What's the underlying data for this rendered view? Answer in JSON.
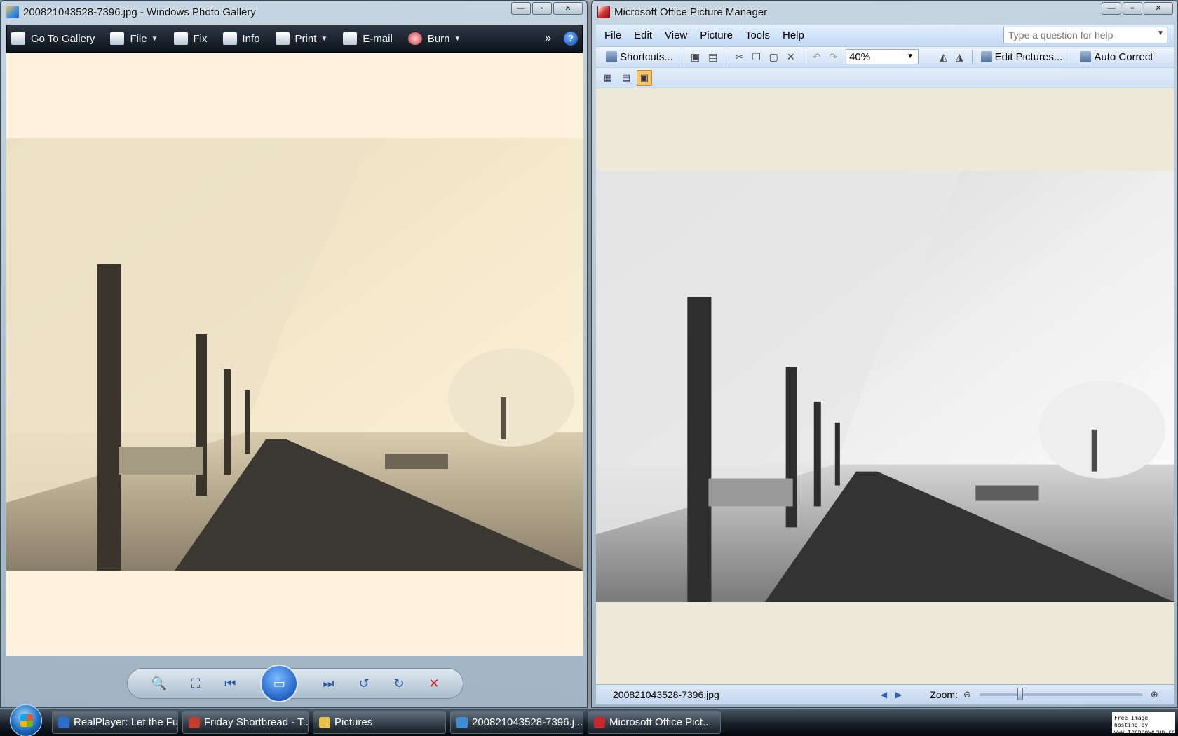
{
  "photo_gallery": {
    "title": "200821043528-7396.jpg - Windows Photo Gallery",
    "toolbar": [
      {
        "label": "Go To Gallery",
        "caret": false
      },
      {
        "label": "File",
        "caret": true
      },
      {
        "label": "Fix",
        "caret": false
      },
      {
        "label": "Info",
        "caret": false
      },
      {
        "label": "Print",
        "caret": true
      },
      {
        "label": "E-mail",
        "caret": false
      },
      {
        "label": "Burn",
        "caret": true
      }
    ],
    "more_label": "»",
    "help_label": "?",
    "controls": {
      "zoom": "🔍",
      "fit": "⛶",
      "prev": "⏮",
      "slideshow": "▭",
      "next": "⏭",
      "rotate_ccw": "↺",
      "rotate_cw": "↻",
      "delete": "✕"
    }
  },
  "picture_manager": {
    "title": "Microsoft Office Picture Manager",
    "menu": [
      "File",
      "Edit",
      "View",
      "Picture",
      "Tools",
      "Help"
    ],
    "help_placeholder": "Type a question for help",
    "toolbar": {
      "shortcuts_label": "Shortcuts...",
      "zoom_value": "40%",
      "edit_pictures_label": "Edit Pictures...",
      "auto_correct_label": "Auto Correct"
    },
    "status": {
      "filename": "200821043528-7396.jpg",
      "zoom_label": "Zoom:",
      "zoom_position": 0.25
    }
  },
  "taskbar": {
    "buttons": [
      {
        "label": "RealPlayer: Let the Fu...",
        "icon_color": "#2a6fd0"
      },
      {
        "label": "Friday Shortbread - T...",
        "icon_color": "#c83a2b"
      },
      {
        "label": "Pictures",
        "icon_color": "#e8c24a"
      },
      {
        "label": "200821043528-7396.j...",
        "icon_color": "#3d8ed8"
      },
      {
        "label": "Microsoft Office Pict...",
        "icon_color": "#c8282e"
      }
    ],
    "tray_text": "Free image hosting by www.techpowerup.com"
  },
  "colors": {
    "gallery_bg": "#fff2de",
    "manager_bg": "#ece9d8"
  }
}
